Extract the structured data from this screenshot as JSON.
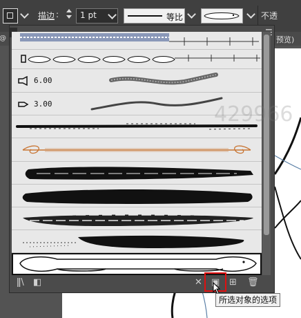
{
  "toolbar": {
    "stroke_label": "描边",
    "stroke_colon": ":",
    "stroke_weight": "1 pt",
    "profile_label": "等比",
    "opacity_label": "不透"
  },
  "strip2": {
    "right_text": "预览)"
  },
  "brushes": {
    "items": [
      {
        "label": ""
      },
      {
        "label": ""
      },
      {
        "label": "6.00"
      },
      {
        "label": "3.00"
      }
    ]
  },
  "footer": {
    "tooltip": "所选对象的选项"
  },
  "watermark": "429966",
  "colors": {
    "highlight": "#e01010",
    "orange_brush": "#c87533"
  }
}
